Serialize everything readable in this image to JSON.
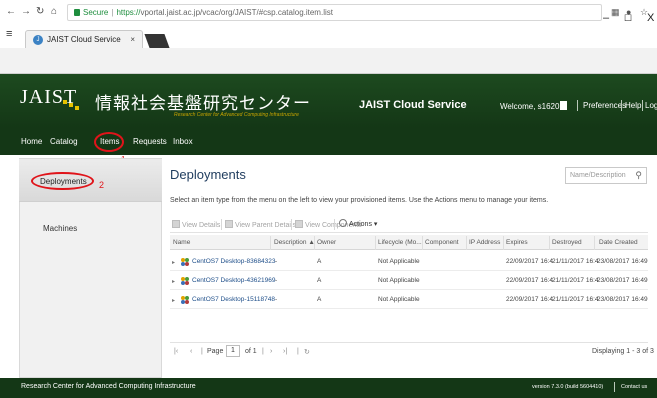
{
  "browser": {
    "tab_title": "JAIST Cloud Service",
    "tab_close": "×",
    "window_min": "–",
    "window_max": "☐",
    "window_close": "X",
    "address": {
      "secure_label": "Secure",
      "scheme": "https://",
      "url_rest": "vportal.jaist.ac.jp/vcac/org/JAIST/#csp.catalog.item.list"
    }
  },
  "header": {
    "logo_text": "JAIST",
    "logo_japanese": "情報社会基盤研究センター",
    "logo_subtitle": "Research Center for Advanced Computing Infrastructure",
    "app_title": "JAIST Cloud Service",
    "welcome": "Welcome, s1620",
    "preferences": "Preferences",
    "help": "Help",
    "logout": "Logout",
    "colors": {
      "header_bg": "#143716",
      "accent": "#e6c200"
    }
  },
  "nav": {
    "items": [
      "Home",
      "Catalog",
      "Items",
      "Requests",
      "Inbox"
    ],
    "annotation_1": "1"
  },
  "left_panel": {
    "items": [
      "Deployments",
      "Machines"
    ],
    "annotation_2": "2"
  },
  "content": {
    "title": "Deployments",
    "search_placeholder": "Name/Description",
    "description": "Select an item type from the menu on the left to view your provisioned items. Use the Actions menu to manage your items.",
    "toolbar": {
      "view_details": "View Details",
      "view_parent_details": "View Parent Details",
      "view_components": "View Components",
      "actions": "Actions ▾"
    },
    "table": {
      "columns": [
        "Name",
        "Description ▲",
        "Owner",
        "Lifecycle (Mo...",
        "Component",
        "IP Address",
        "Expires",
        "Destroyed",
        "Date Created"
      ],
      "rows": [
        {
          "name": "CentOS7 Desktop-83684323",
          "description": "-",
          "owner": "A",
          "lifecycle": "Not Applicable",
          "component": "",
          "ip": "",
          "expires": "22/09/2017 16:4",
          "destroyed": "21/11/2017 16:4",
          "created": "23/08/2017 16:49"
        },
        {
          "name": "CentOS7 Desktop-43621969",
          "description": "-",
          "owner": "A",
          "lifecycle": "Not Applicable",
          "component": "",
          "ip": "",
          "expires": "22/09/2017 16:4",
          "destroyed": "21/11/2017 16:4",
          "created": "23/08/2017 16:49"
        },
        {
          "name": "CentOS7 Desktop-15118748",
          "description": "-",
          "owner": "A",
          "lifecycle": "Not Applicable",
          "component": "",
          "ip": "",
          "expires": "22/09/2017 16:4",
          "destroyed": "21/11/2017 16:4",
          "created": "23/08/2017 16:49"
        }
      ]
    },
    "pager": {
      "page_label": "Page",
      "page_value": "1",
      "of_label": "of 1",
      "displaying": "Displaying 1 - 3 of 3"
    }
  },
  "footer": {
    "left": "Research Center for Advanced Computing Infrastructure",
    "version": "version 7.3.0 (build 5604410)",
    "contact": "Contact us"
  }
}
